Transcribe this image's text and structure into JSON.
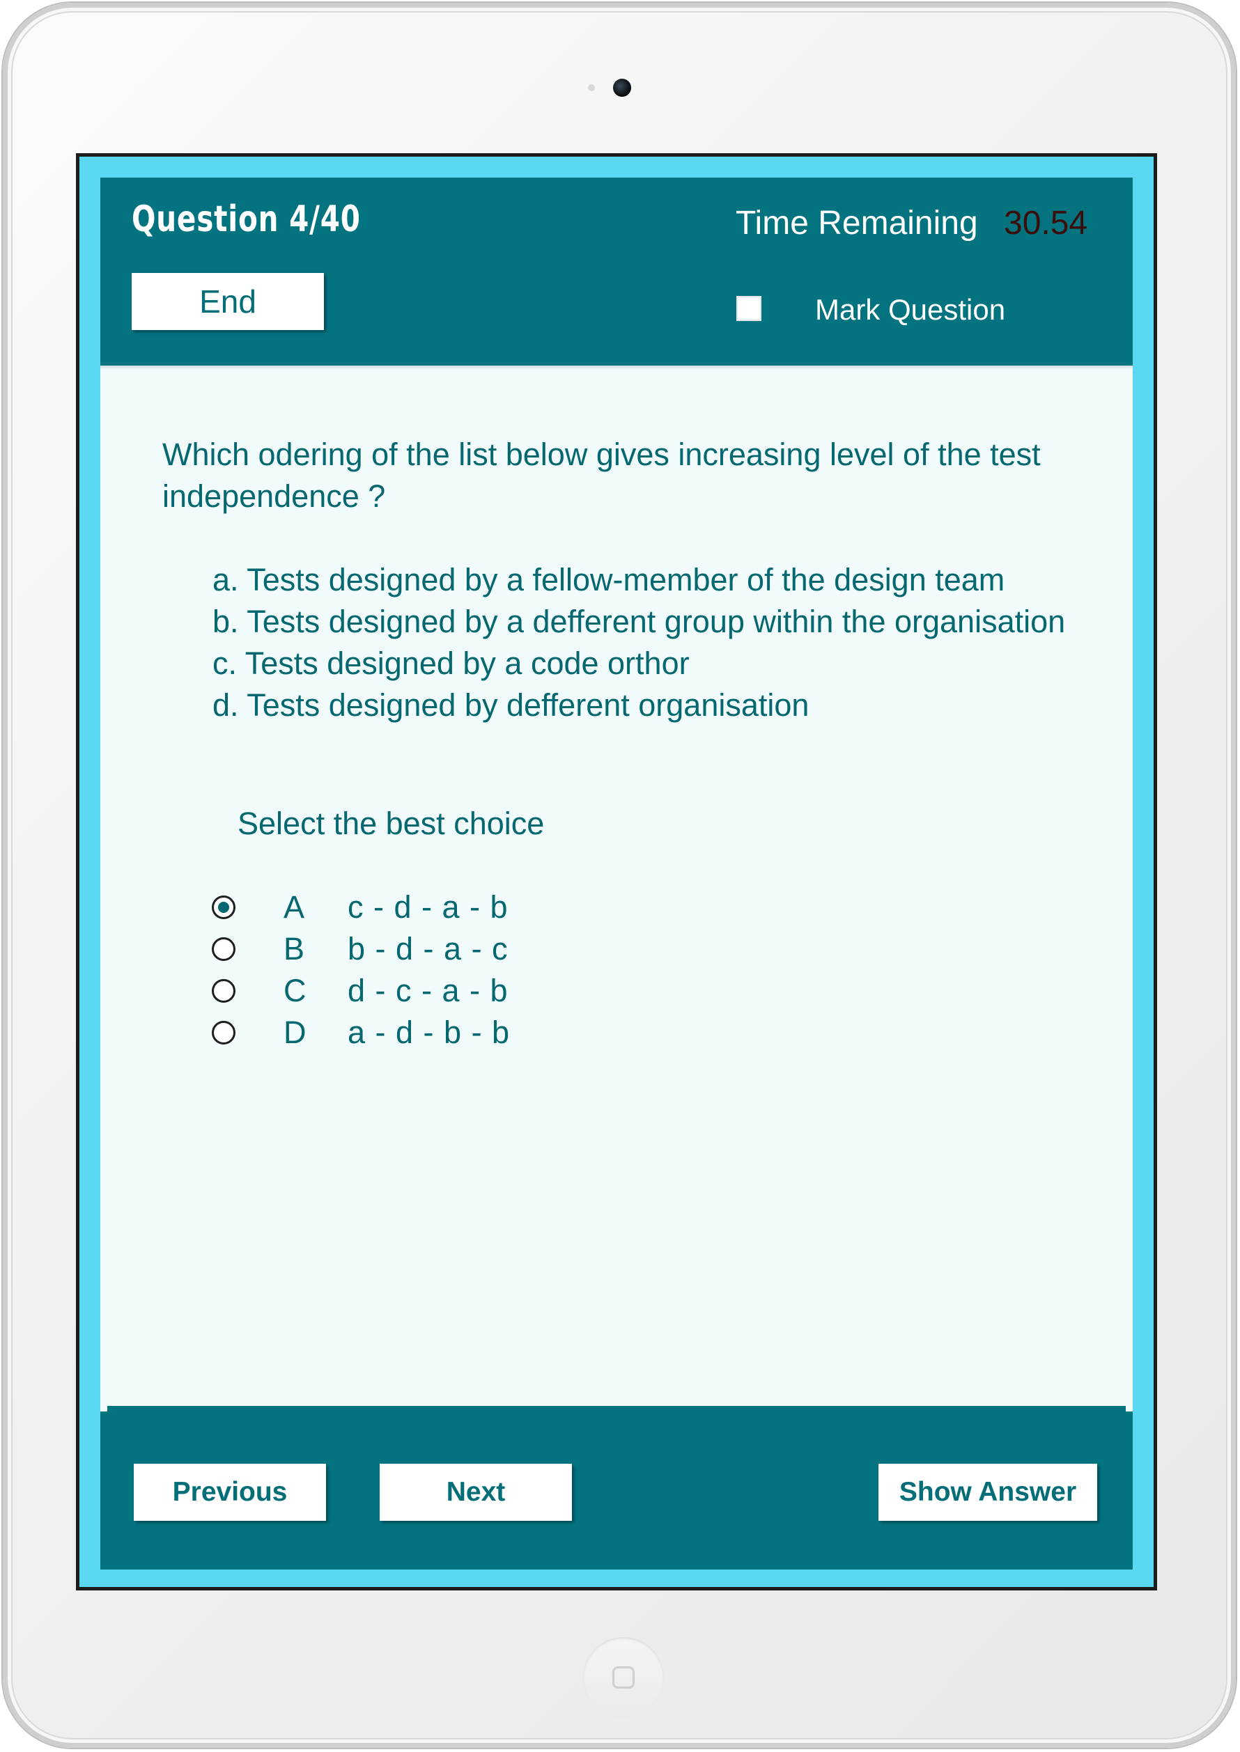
{
  "header": {
    "question_counter": "Question 4/40",
    "end_label": "End",
    "time_label": "Time Remaining",
    "time_value": "30.54",
    "mark_label": "Mark Question",
    "mark_checked": false
  },
  "question": {
    "text": "Which odering of the list below gives increasing level of the test independence ?",
    "items": [
      "a. Tests designed by a fellow-member of the design team",
      "b. Tests designed by a defferent group within the organisation",
      "c. Tests designed by a code orthor",
      "d. Tests designed by defferent organisation"
    ],
    "instruction": "Select the best choice"
  },
  "options": [
    {
      "letter": "A",
      "text": "c - d - a - b",
      "selected": true
    },
    {
      "letter": "B",
      "text": "b - d - a - c",
      "selected": false
    },
    {
      "letter": "C",
      "text": "d - c - a - b",
      "selected": false
    },
    {
      "letter": "D",
      "text": "a - d - b - b",
      "selected": false
    }
  ],
  "footer": {
    "previous_label": "Previous",
    "next_label": "Next",
    "show_answer_label": "Show Answer"
  },
  "colors": {
    "header_bg": "#037380",
    "frame": "#5ad8f3",
    "content_bg": "#f1fbfc",
    "text": "#05676f",
    "timer": "#3a0e0a"
  }
}
